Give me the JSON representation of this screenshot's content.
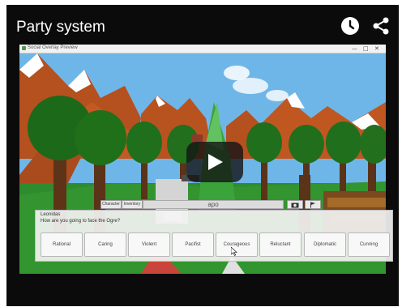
{
  "video": {
    "title": "Party system",
    "icons": {
      "watch_later": "clock-icon",
      "share": "share-icon",
      "play": "play-icon"
    }
  },
  "app_window": {
    "title": "Social Overlay Preview",
    "controls": {
      "minimize": "—",
      "maximize": "□",
      "close": "✕"
    }
  },
  "toolbar": {
    "character_label": "Character",
    "inventory_label": "Inventory",
    "input_value": "apo"
  },
  "dialog": {
    "speaker": "Leonidas",
    "question": "How are you going to face the Ogre?",
    "choices": [
      "Rational",
      "Caring",
      "Violent",
      "Pacifist",
      "Courageous",
      "Reluctant",
      "Diplomatic",
      "Cunning"
    ]
  },
  "colors": {
    "sky": "#6fb6e8",
    "grass": "#2f8c2e",
    "tree_leaf": "#1f6f1c",
    "trunk": "#5b3318",
    "mountain": "#b5501f",
    "snow": "#ffffff"
  }
}
